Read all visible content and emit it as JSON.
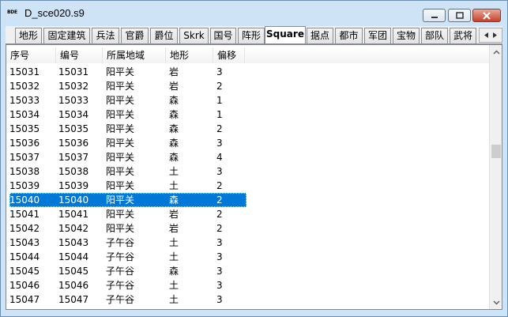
{
  "window": {
    "icon_label": "BDE",
    "title": "D_sce020.s9"
  },
  "tabs": [
    {
      "label": "地形"
    },
    {
      "label": "固定建筑"
    },
    {
      "label": "兵法"
    },
    {
      "label": "官爵"
    },
    {
      "label": "爵位"
    },
    {
      "label": "Skrk"
    },
    {
      "label": "国号"
    },
    {
      "label": "阵形"
    },
    {
      "label": "Square",
      "active": true
    },
    {
      "label": "据点"
    },
    {
      "label": "都市"
    },
    {
      "label": "军团"
    },
    {
      "label": "宝物"
    },
    {
      "label": "部队"
    },
    {
      "label": "武将"
    }
  ],
  "table": {
    "columns": [
      "序号",
      "编号",
      "所属地域",
      "地形",
      "偏移"
    ],
    "rows": [
      [
        "15031",
        "15031",
        "阳平关",
        "岩",
        "3"
      ],
      [
        "15032",
        "15032",
        "阳平关",
        "岩",
        "2"
      ],
      [
        "15033",
        "15033",
        "阳平关",
        "森",
        "1"
      ],
      [
        "15034",
        "15034",
        "阳平关",
        "森",
        "1"
      ],
      [
        "15035",
        "15035",
        "阳平关",
        "森",
        "2"
      ],
      [
        "15036",
        "15036",
        "阳平关",
        "森",
        "3"
      ],
      [
        "15037",
        "15037",
        "阳平关",
        "森",
        "4"
      ],
      [
        "15038",
        "15038",
        "阳平关",
        "土",
        "3"
      ],
      [
        "15039",
        "15039",
        "阳平关",
        "土",
        "2"
      ],
      [
        "15040",
        "15040",
        "阳平关",
        "森",
        "2"
      ],
      [
        "15041",
        "15041",
        "阳平关",
        "岩",
        "2"
      ],
      [
        "15042",
        "15042",
        "阳平关",
        "岩",
        "2"
      ],
      [
        "15043",
        "15043",
        "子午谷",
        "土",
        "3"
      ],
      [
        "15044",
        "15044",
        "子午谷",
        "土",
        "3"
      ],
      [
        "15045",
        "15045",
        "子午谷",
        "森",
        "3"
      ],
      [
        "15046",
        "15046",
        "子午谷",
        "土",
        "3"
      ],
      [
        "15047",
        "15047",
        "子午谷",
        "土",
        "3"
      ]
    ],
    "selected_row": "15040"
  },
  "colors": {
    "selection": "#0078d7",
    "titlebar": "#cfe3f7",
    "close_button": "#c7402b"
  }
}
